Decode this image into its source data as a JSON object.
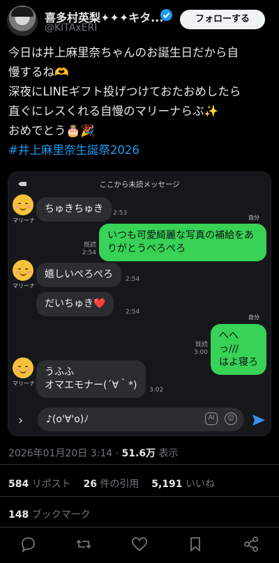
{
  "author": {
    "name": "喜多村英梨✦✦✦キタ...",
    "handle": "@KITAxERI",
    "follow_label": "フォローする"
  },
  "tweet": {
    "line1": "今日は井上麻里奈ちゃんのお誕生日だから自",
    "line2": "慢するね🫶",
    "line3": "深夜にLINEギフト投げつけておたおめしたら",
    "line4": "直ぐにレスくれる自慢のマリーナらぶ✨",
    "line5": "おめでとう🎂🎉",
    "hashtag": "#井上麻里奈生誕祭2026"
  },
  "chat": {
    "header": "ここから未読メッセージ",
    "contact_label": "マリーナ",
    "self_label": "自分",
    "messages": [
      {
        "from": "them",
        "text": "ちゅきちゅき",
        "time": "2:53"
      },
      {
        "from": "me",
        "text_line1": "いつも可愛綺麗な写真の補給をあ",
        "text_line2": "りがとうぺろぺろ",
        "read": "既読",
        "time": "2:54"
      },
      {
        "from": "them",
        "text": "嬉しいぺろぺろ",
        "time": "2:54"
      },
      {
        "from": "them",
        "text": "だいちゅき❤️",
        "time": "2:54"
      },
      {
        "from": "me",
        "text_line1": "へへっ///",
        "text_line2": "はよ寝ろ",
        "read": "既読",
        "time": "3:00"
      },
      {
        "from": "them",
        "text_line1": "うふふ",
        "text_line2": "オマエモナー(´∀｀*)",
        "time": "3:02"
      }
    ],
    "input_value": "♪(o'∀'o)ﾉ",
    "ai_label": "AI"
  },
  "meta": {
    "datetime": "2026年01月20日 3:14",
    "sep": " · ",
    "views_count": "51.6万",
    "views_label": " 表示"
  },
  "stats": {
    "reposts_count": "584",
    "reposts_label": " リポスト",
    "quotes_count": "26",
    "quotes_label": " 件の引用",
    "likes_count": "5,191",
    "likes_label": " いいね",
    "bookmarks_count": "148",
    "bookmarks_label": " ブックマーク"
  },
  "colors": {
    "accent": "#1d9bf0",
    "line_green": "#37d256",
    "background": "#000000"
  }
}
